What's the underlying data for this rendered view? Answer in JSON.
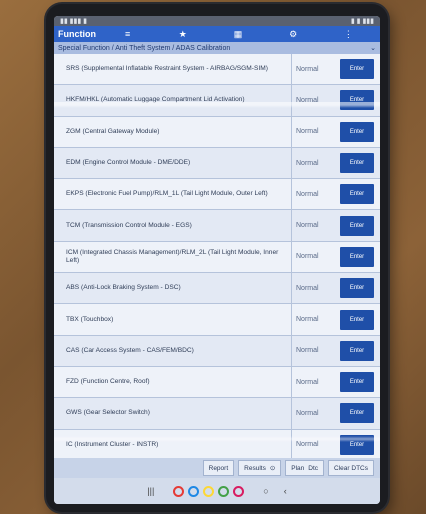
{
  "app": {
    "title": "Function",
    "top_icons": [
      "≡",
      "★",
      "▦",
      "⚙",
      "⋮"
    ]
  },
  "breadcrumb": {
    "text": "Special Function / Anti Theft System / ADAS Calibration"
  },
  "modules": [
    {
      "name": "SRS (Supplemental Inflatable Restraint System - AIRBAG/SGM-SIM)",
      "status": "Normal",
      "button": "Enter"
    },
    {
      "name": "HKFM/HKL (Automatic Luggage Compartment Lid Activation)",
      "status": "Normal",
      "button": "Enter"
    },
    {
      "name": "ZGM (Central Gateway Module)",
      "status": "Normal",
      "button": "Enter"
    },
    {
      "name": "EDM (Engine Control Module - DME/DDE)",
      "status": "Normal",
      "button": "Enter"
    },
    {
      "name": "EKPS (Electronic Fuel Pump)/RLM_1L (Tail Light Module, Outer Left)",
      "status": "Normal",
      "button": "Enter"
    },
    {
      "name": "TCM (Transmission Control Module - EGS)",
      "status": "Normal",
      "button": "Enter"
    },
    {
      "name": "ICM (Integrated Chassis Management)/RLM_2L (Tail Light Module, Inner Left)",
      "status": "Normal",
      "button": "Enter"
    },
    {
      "name": "ABS (Anti-Lock Braking System - DSC)",
      "status": "Normal",
      "button": "Enter"
    },
    {
      "name": "TBX (Touchbox)",
      "status": "Normal",
      "button": "Enter"
    },
    {
      "name": "CAS (Car Access System - CAS/FEM/BDC)",
      "status": "Normal",
      "button": "Enter"
    },
    {
      "name": "FZD (Function Centre, Roof)",
      "status": "Normal",
      "button": "Enter"
    },
    {
      "name": "GWS (Gear Selector Switch)",
      "status": "Normal",
      "button": "Enter"
    },
    {
      "name": "IC (Instrument Cluster - INSTR)",
      "status": "Normal",
      "button": "Enter"
    }
  ],
  "bottom": {
    "report": "Report",
    "results": "Results",
    "results_icon": "⊙",
    "plan": "Plan",
    "dtc": "Dtc",
    "clear": "Clear DTCs"
  },
  "nav_apps": [
    {
      "color": "#e53935",
      "name": "app-red-icon"
    },
    {
      "color": "#1e88e5",
      "name": "app-blue-icon"
    },
    {
      "color": "#fdd835",
      "name": "app-yellow-icon"
    },
    {
      "color": "#43a047",
      "name": "app-green-icon"
    },
    {
      "color": "#d81b60",
      "name": "app-pink-icon"
    }
  ]
}
